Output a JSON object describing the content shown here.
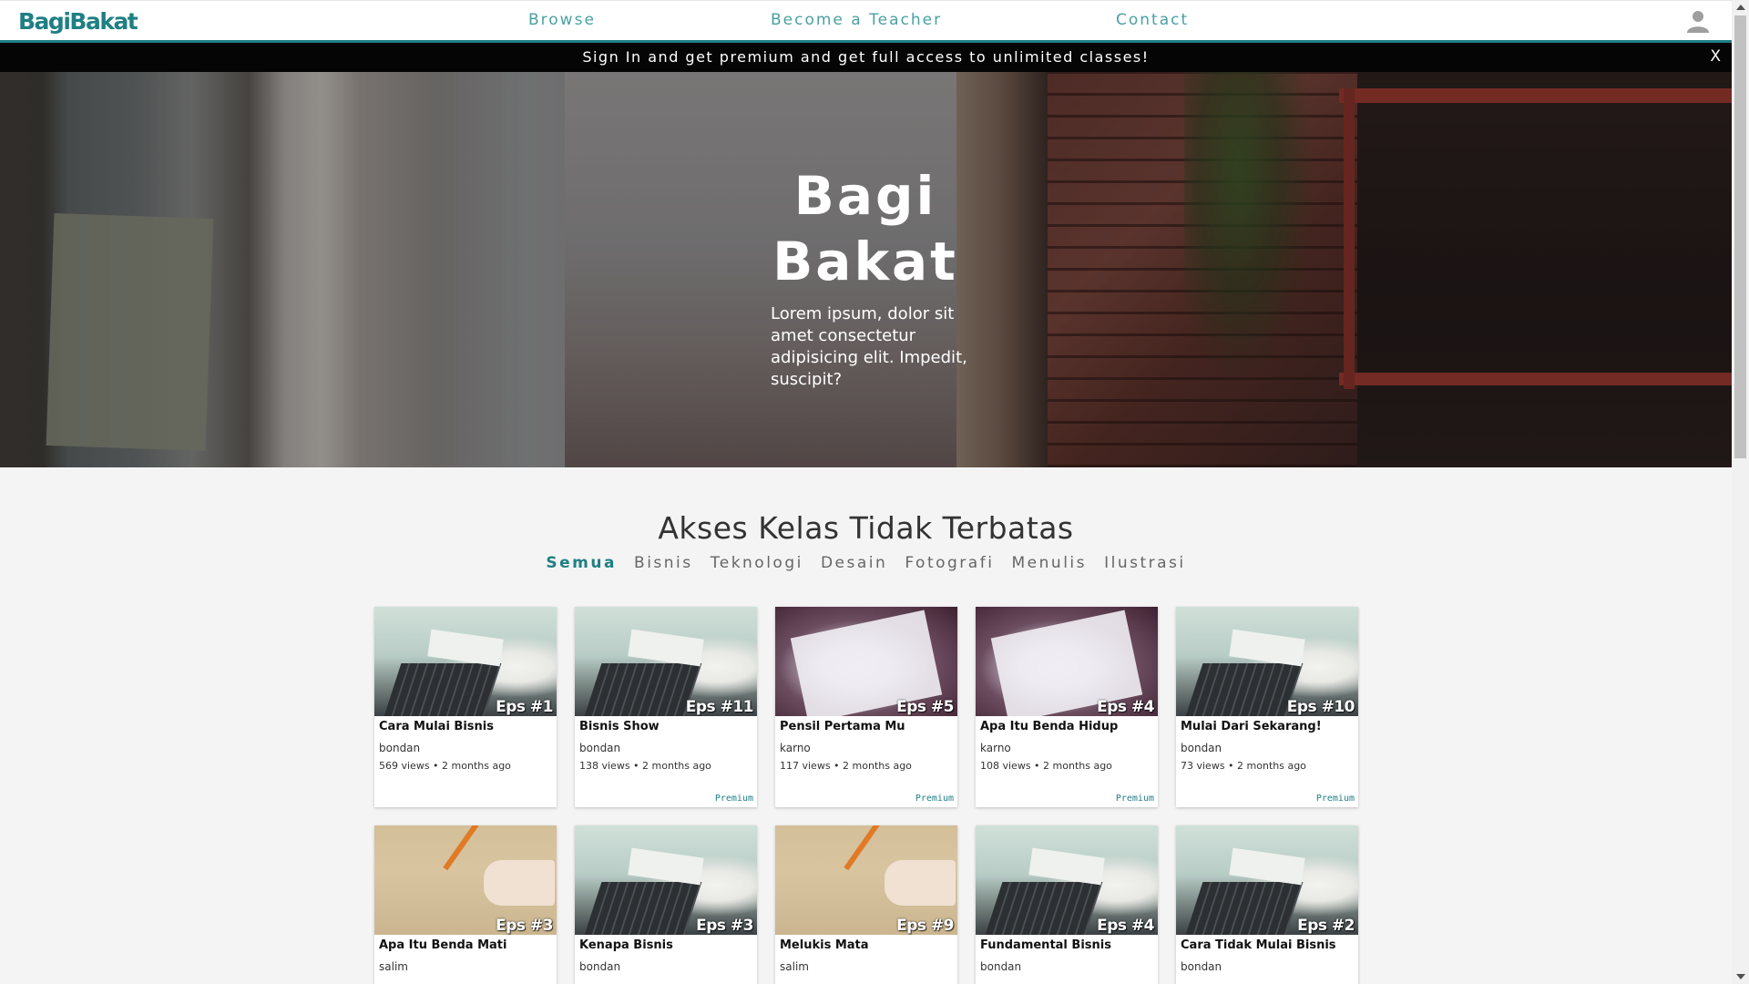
{
  "header": {
    "logo": "BagiBakat",
    "nav": [
      "Browse",
      "Become a Teacher",
      "Contact"
    ]
  },
  "promo": {
    "text": "Sign In and get premium and get full access to unlimited classes!",
    "close_label": "X"
  },
  "hero": {
    "title": "Bagi Bakat",
    "text": "Lorem ipsum, dolor sit amet consectetur adipisicing elit. Impedit, suscipit?"
  },
  "section": {
    "title": "Akses Kelas Tidak Terbatas",
    "categories": [
      "Semua",
      "Bisnis",
      "Teknologi",
      "Desain",
      "Fotografi",
      "Menulis",
      "Ilustrasi"
    ],
    "active_category": "Semua"
  },
  "cards": [
    {
      "title": "Cara Mulai Bisnis",
      "author": "bondan",
      "meta": "569 views • 2 months ago",
      "eps": "Eps #1",
      "premium": "",
      "thumb": "laptop"
    },
    {
      "title": "Bisnis Show",
      "author": "bondan",
      "meta": "138 views • 2 months ago",
      "eps": "Eps #11",
      "premium": "Premium",
      "thumb": "laptop"
    },
    {
      "title": "Pensil Pertama Mu",
      "author": "karno",
      "meta": "117 views • 2 months ago",
      "eps": "Eps #5",
      "premium": "Premium",
      "thumb": "clipboard"
    },
    {
      "title": "Apa Itu Benda Hidup",
      "author": "karno",
      "meta": "108 views • 2 months ago",
      "eps": "Eps #4",
      "premium": "Premium",
      "thumb": "clipboard"
    },
    {
      "title": "Mulai Dari Sekarang!",
      "author": "bondan",
      "meta": "73 views • 2 months ago",
      "eps": "Eps #10",
      "premium": "Premium",
      "thumb": "laptop"
    },
    {
      "title": "Apa Itu Benda Mati",
      "author": "salim",
      "meta": "",
      "eps": "Eps #3",
      "premium": "",
      "thumb": "pen"
    },
    {
      "title": "Kenapa Bisnis",
      "author": "bondan",
      "meta": "",
      "eps": "Eps #3",
      "premium": "",
      "thumb": "laptop"
    },
    {
      "title": "Melukis Mata",
      "author": "salim",
      "meta": "",
      "eps": "Eps #9",
      "premium": "",
      "thumb": "pen"
    },
    {
      "title": "Fundamental Bisnis",
      "author": "bondan",
      "meta": "",
      "eps": "Eps #4",
      "premium": "",
      "thumb": "laptop"
    },
    {
      "title": "Cara Tidak Mulai Bisnis",
      "author": "bondan",
      "meta": "",
      "eps": "Eps #2",
      "premium": "",
      "thumb": "laptop"
    }
  ],
  "colors": {
    "accent": "#1f7f83",
    "promo_bg": "#050505",
    "page_bg": "#f4f4f4"
  }
}
